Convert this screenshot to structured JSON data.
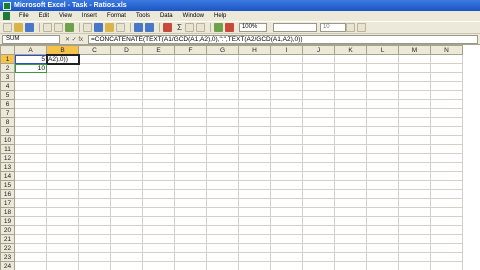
{
  "window": {
    "title": "Microsoft Excel - Task - Ratios.xls"
  },
  "menu": [
    "File",
    "Edit",
    "View",
    "Insert",
    "Format",
    "Tools",
    "Data",
    "Window",
    "Help"
  ],
  "toolbar": {
    "zoom": "100%",
    "font": "",
    "size": "10"
  },
  "formula_bar": {
    "name_box": "SUM",
    "buttons": "✕ ✓ fx",
    "formula": "=CONCATENATE(TEXT(A1/GCD(A1,A2),0),\":\",TEXT(A2/GCD(A1,A2),0))"
  },
  "grid": {
    "columns": [
      "A",
      "B",
      "C",
      "D",
      "E",
      "F",
      "G",
      "H",
      "I",
      "J",
      "K",
      "L",
      "M",
      "N"
    ],
    "rows": [
      "1",
      "2",
      "3",
      "4",
      "5",
      "6",
      "7",
      "8",
      "9",
      "10",
      "11",
      "12",
      "13",
      "14",
      "15",
      "16",
      "17",
      "18",
      "19",
      "20",
      "21",
      "22",
      "23",
      "24",
      "25"
    ],
    "cells": {
      "A1": "5",
      "A2": "10",
      "B1": "A2),0))"
    },
    "active_cell": "B1"
  }
}
